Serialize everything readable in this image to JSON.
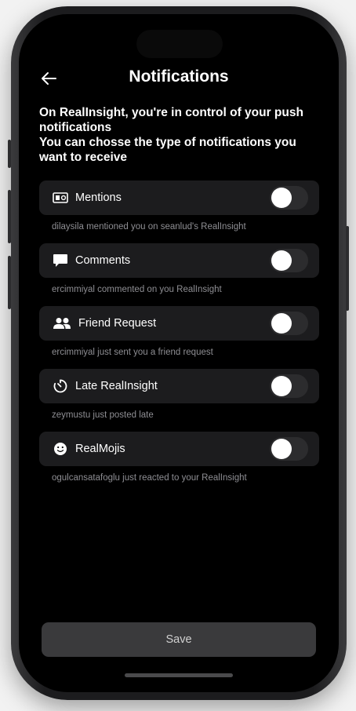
{
  "header": {
    "title": "Notifications"
  },
  "intro": {
    "line1": "On RealInsight, you're in control of your push notifications",
    "line2": "You can chosse the type of notifications you want to receive"
  },
  "settings": [
    {
      "label": "Mentions",
      "icon": "mention-card-icon",
      "description": "dilaysila mentioned you on seanlud's RealInsight",
      "enabled": false
    },
    {
      "label": "Comments",
      "icon": "comment-bubble-icon",
      "description": "ercimmiyal commented on you RealInsight",
      "enabled": false
    },
    {
      "label": "Friend Request",
      "icon": "people-icon",
      "description": "ercimmiyal just sent you a friend request",
      "enabled": false
    },
    {
      "label": "Late RealInsight",
      "icon": "timer-icon",
      "description": "zeymustu just posted late",
      "enabled": false
    },
    {
      "label": "RealMojis",
      "icon": "smiley-icon",
      "description": "ogulcansatafoglu just reacted to your RealInsight",
      "enabled": false
    }
  ],
  "save_label": "Save"
}
